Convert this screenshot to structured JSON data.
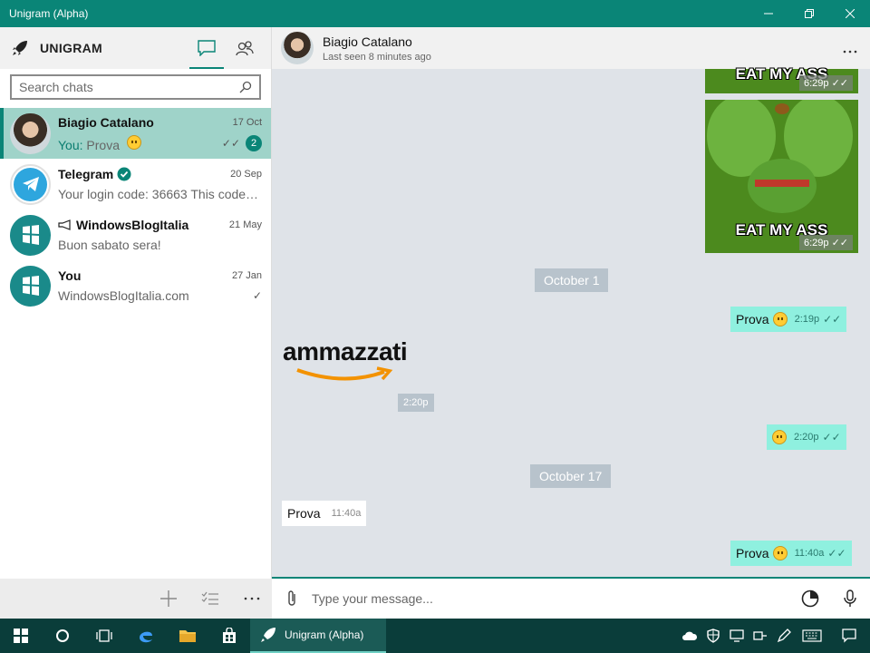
{
  "window": {
    "title": "Unigram (Alpha)"
  },
  "sidebar": {
    "brand": "UNIGRAM",
    "search_placeholder": "Search chats",
    "chats": [
      {
        "name": "Biagio Catalano",
        "date": "17 Oct",
        "prefix": "You:",
        "preview": "Prova",
        "badge": "2",
        "ticks": "✓✓"
      },
      {
        "name": "Telegram",
        "date": "20 Sep",
        "preview": "Your login code: 36663  This code…"
      },
      {
        "name": "WindowsBlogItalia",
        "date": "21 May",
        "preview": "Buon sabato sera!"
      },
      {
        "name": "You",
        "date": "27 Jan",
        "preview": "WindowsBlogItalia.com",
        "ticks": "✓"
      }
    ]
  },
  "conversation": {
    "name": "Biagio Catalano",
    "status": "Last seen 8 minutes ago",
    "stickers": [
      {
        "text": "EAT MY ASS",
        "time": "6:29p"
      },
      {
        "text": "EAT MY ASS",
        "time": "6:29p"
      }
    ],
    "dates": [
      "October 1",
      "October 17"
    ],
    "messages": [
      {
        "text": "Prova",
        "time": "2:19p"
      },
      {
        "text": "ammazzati",
        "time": "2:20p"
      },
      {
        "text": "",
        "time": "2:20p"
      },
      {
        "text": "Prova",
        "time": "11:40a"
      },
      {
        "text": "Prova",
        "time": "11:40a"
      }
    ],
    "composer_placeholder": "Type your message..."
  },
  "taskbar": {
    "app_label": "Unigram (Alpha)"
  },
  "colors": {
    "accent": "#0a8577",
    "outgoing": "#8ff0df",
    "selected": "#9fd3c9"
  }
}
